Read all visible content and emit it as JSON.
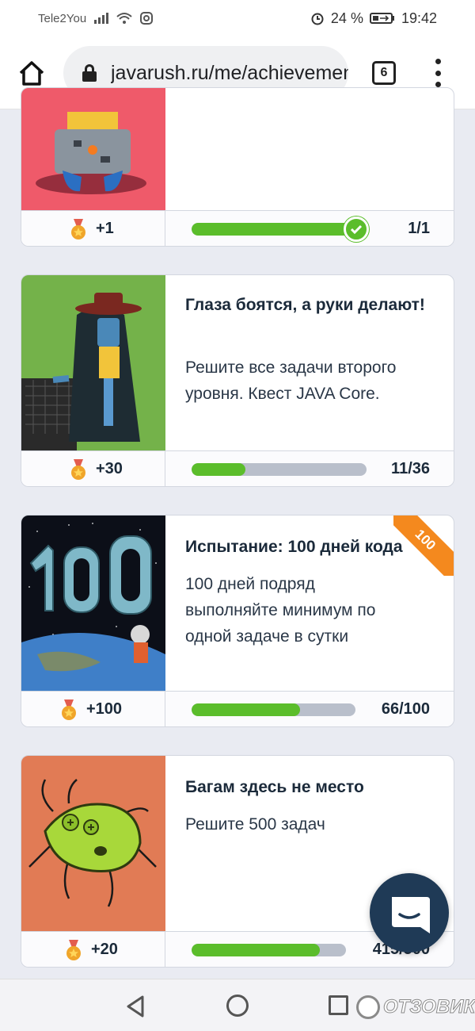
{
  "status_bar": {
    "carrier": "Tele2You",
    "battery": "24 %",
    "time": "19:42"
  },
  "browser": {
    "url": "javarush.ru/me/achievements",
    "tabs_count": "6"
  },
  "cards": [
    {
      "title": "",
      "description": "",
      "reward": "+1",
      "progress_text": "1/1",
      "progress": 1.0,
      "completed": true
    },
    {
      "title": "Глаза боятся, а руки делают!",
      "description": "Решите все задачи второго уровня. Квест JAVA Core.",
      "reward": "+30",
      "progress_text": "11/36",
      "progress": 0.306
    },
    {
      "title": "Испытание: 100 дней кода",
      "description": "100 дней подряд выполняйте минимум по одной задаче в сутки",
      "reward": "+100",
      "progress_text": "66/100",
      "progress": 0.66,
      "ribbon": "100"
    },
    {
      "title": "Багам здесь не место",
      "description": "Решите 500 задач",
      "reward": "+20",
      "progress_text": "415/500",
      "progress": 0.83
    }
  ],
  "watermark": "ОТЗОВИК",
  "colors": {
    "progress_fill": "#5bbd2b",
    "progress_track": "#b9bfcb",
    "ribbon": "#f4891e",
    "chat_button": "#1f3a56",
    "page_bg": "#e9ebf2"
  },
  "icons": [
    "home-icon",
    "lock-icon",
    "tabs-icon",
    "more-vert-icon",
    "medal-icon",
    "check-icon",
    "chat-icon",
    "nav-back-icon",
    "nav-home-icon",
    "nav-recent-icon"
  ]
}
